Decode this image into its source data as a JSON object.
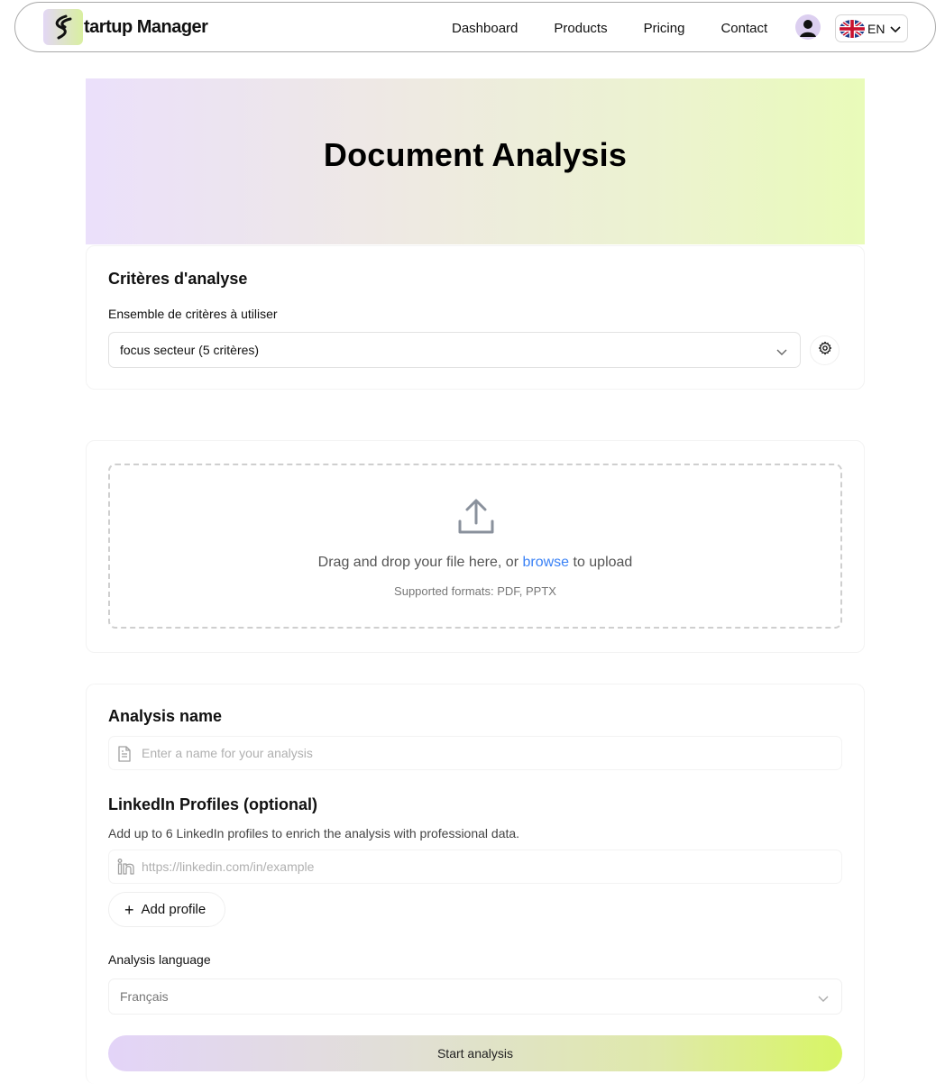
{
  "nav": {
    "brand": "tartup Manager",
    "links": [
      "Dashboard",
      "Products",
      "Pricing",
      "Contact"
    ],
    "language": "EN"
  },
  "hero": {
    "title": "Document Analysis"
  },
  "criteria": {
    "title": "Critères d'analyse",
    "set_label": "Ensemble de critères à utiliser",
    "selected": "focus secteur (5 critères)"
  },
  "upload": {
    "text_before": "Drag and drop your file here, or ",
    "browse": "browse",
    "text_after": " to upload",
    "formats": "Supported formats: PDF, PPTX"
  },
  "analysis": {
    "name_title": "Analysis name",
    "name_placeholder": "Enter a name for your analysis",
    "linkedin_title": "LinkedIn Profiles (optional)",
    "linkedin_help": "Add up to 6 LinkedIn profiles to enrich the analysis with professional data.",
    "linkedin_placeholder": "https://linkedin.com/in/example",
    "add_profile": "Add profile",
    "language_label": "Analysis language",
    "language_value": "Français",
    "start": "Start analysis"
  },
  "colors": {
    "accent_link": "#3b82f6",
    "gradient_start": "#e3d4f8",
    "gradient_end": "#d8f564"
  }
}
